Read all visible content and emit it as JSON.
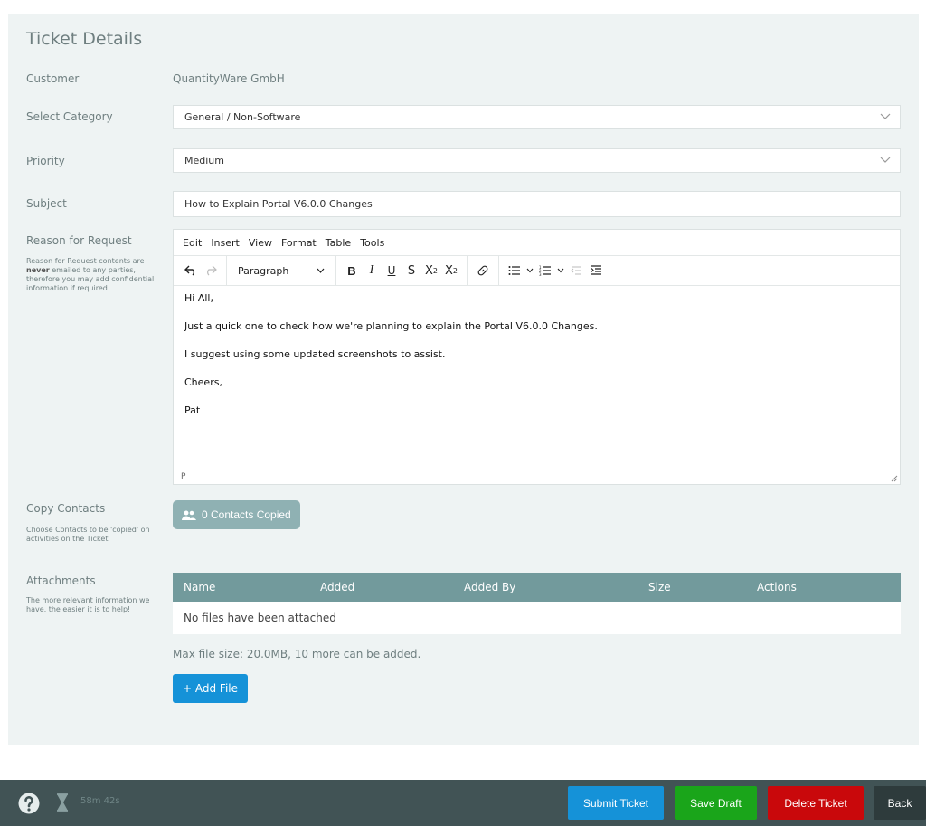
{
  "page": {
    "title": "Ticket Details"
  },
  "customer": {
    "label": "Customer",
    "value": "QuantityWare GmbH"
  },
  "category": {
    "label": "Select Category",
    "value": "General / Non-Software"
  },
  "priority": {
    "label": "Priority",
    "value": "Medium"
  },
  "subject": {
    "label": "Subject",
    "value": "How to Explain Portal V6.0.0 Changes"
  },
  "reason": {
    "label": "Reason for Request",
    "help_prefix": "Reason for Request contents are ",
    "help_bold": "never",
    "help_suffix": " emailed to any parties, therefore you may add confidential information if required."
  },
  "editor": {
    "menu": [
      "Edit",
      "Insert",
      "View",
      "Format",
      "Table",
      "Tools"
    ],
    "block_format": "Paragraph",
    "content": [
      "Hi All,",
      "Just a quick one to check how we're planning to explain the Portal V6.0.0 Changes.",
      "I suggest using some updated screenshots to assist.",
      "Cheers,",
      "Pat"
    ],
    "status_path": "P"
  },
  "contacts": {
    "label": "Copy Contacts",
    "help": "Choose Contacts to be 'copied' on activities on the Ticket",
    "button": "0 Contacts Copied"
  },
  "attachments": {
    "label": "Attachments",
    "help": "The more relevant information we have, the easier it is to help!",
    "columns": [
      "Name",
      "Added",
      "Added By",
      "Size",
      "Actions"
    ],
    "empty": "No files have been attached",
    "max_info": "Max file size: 20.0MB, 10 more can be added.",
    "add_button": "+ Add File"
  },
  "footer": {
    "timer": "58m 42s",
    "submit": "Submit Ticket",
    "save": "Save Draft",
    "delete": "Delete Ticket",
    "back": "Back"
  },
  "colors": {
    "submit": "#1592d8",
    "save": "#1aa51a",
    "delete": "#c9080b",
    "back": "#2e3b3c",
    "table_header": "#729a9c"
  }
}
